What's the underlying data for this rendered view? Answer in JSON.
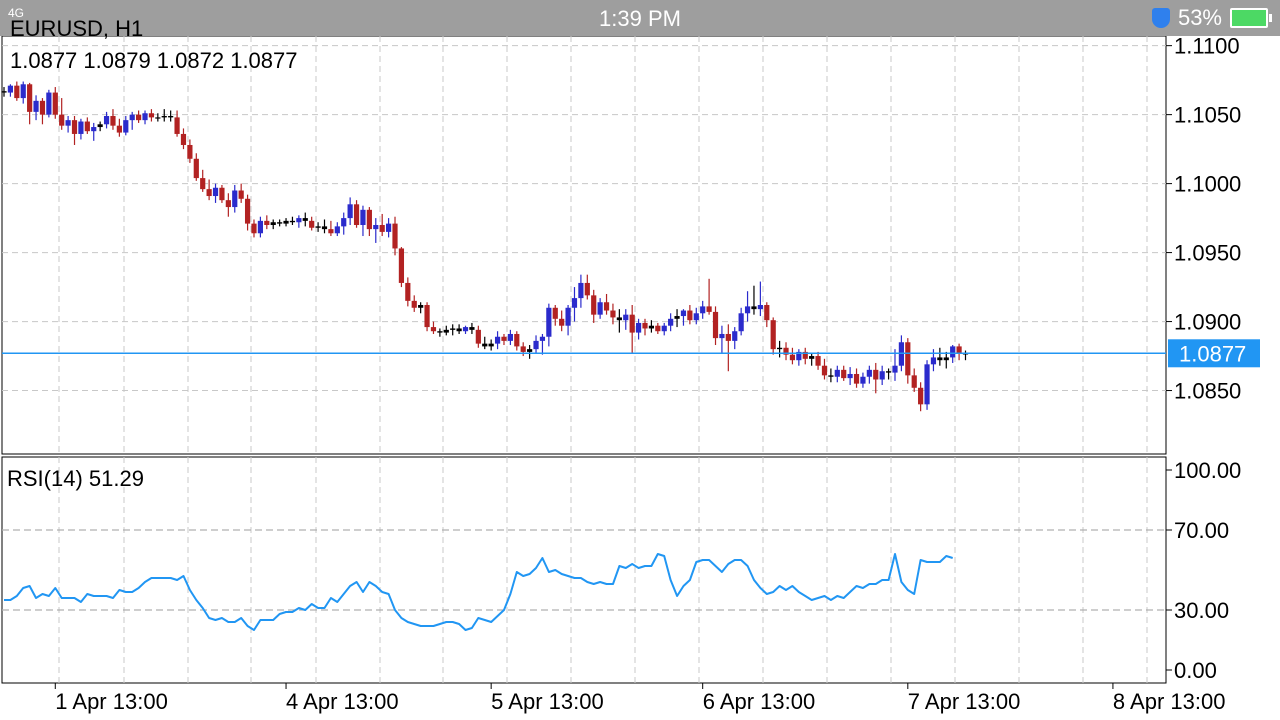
{
  "status_bar": {
    "time": "1:39 PM",
    "battery": "53%",
    "network": "4G"
  },
  "header": {
    "symbol_timeframe": "EURUSD, H1",
    "ohlc": "1.0877 1.0879 1.0872 1.0877"
  },
  "rsi_panel": {
    "label": "RSI(14) 51.29"
  },
  "colors": {
    "bull": "#2b2bcc",
    "bear": "#b22222",
    "rsi_line": "#2196f3",
    "price_line": "#2196f3",
    "grid": "#c8c8c8"
  },
  "chart_data": [
    {
      "type": "candlestick",
      "symbol": "EURUSD",
      "timeframe": "H1",
      "current_price": "1.0877",
      "y_ticks": [
        "1.1100",
        "1.1050",
        "1.1000",
        "1.0950",
        "1.0900",
        "1.0850"
      ],
      "ylim": [
        1.0804,
        1.1107
      ],
      "x_ticks": [
        "1 Apr 13:00",
        "4 Apr 13:00",
        "5 Apr 13:00",
        "6 Apr 13:00",
        "7 Apr 13:00",
        "8 Apr 13:00"
      ],
      "x_tick_bar_index": [
        8,
        44,
        76,
        109,
        141,
        173
      ],
      "candles": [
        [
          1.1067,
          1.107,
          1.1063,
          1.1066
        ],
        [
          1.1066,
          1.1072,
          1.1063,
          1.1071
        ],
        [
          1.1071,
          1.1074,
          1.106,
          1.1062
        ],
        [
          1.1062,
          1.1074,
          1.1058,
          1.1072
        ],
        [
          1.1072,
          1.1073,
          1.1043,
          1.1052
        ],
        [
          1.1052,
          1.1064,
          1.1046,
          1.106
        ],
        [
          1.106,
          1.1062,
          1.1043,
          1.105
        ],
        [
          1.105,
          1.1068,
          1.1048,
          1.1066
        ],
        [
          1.1066,
          1.107,
          1.1047,
          1.105
        ],
        [
          1.105,
          1.1062,
          1.1039,
          1.1042
        ],
        [
          1.1042,
          1.1049,
          1.1037,
          1.1046
        ],
        [
          1.1046,
          1.1049,
          1.1028,
          1.1036
        ],
        [
          1.1036,
          1.1047,
          1.1032,
          1.1045
        ],
        [
          1.1045,
          1.1048,
          1.1036,
          1.1038
        ],
        [
          1.1038,
          1.1044,
          1.1031,
          1.1041
        ],
        [
          1.1041,
          1.1045,
          1.1038,
          1.1043
        ],
        [
          1.1043,
          1.1052,
          1.104,
          1.1049
        ],
        [
          1.1049,
          1.1054,
          1.1039,
          1.1042
        ],
        [
          1.1042,
          1.1047,
          1.1034,
          1.1037
        ],
        [
          1.1037,
          1.1049,
          1.1035,
          1.1046
        ],
        [
          1.1046,
          1.1052,
          1.1039,
          1.105
        ],
        [
          1.105,
          1.1053,
          1.1044,
          1.1046
        ],
        [
          1.1046,
          1.1053,
          1.1043,
          1.1051
        ],
        [
          1.1051,
          1.1054,
          1.1045,
          1.1048
        ],
        [
          1.1048,
          1.1051,
          1.1045,
          1.1048
        ],
        [
          1.1048,
          1.1054,
          1.1045,
          1.1049
        ],
        [
          1.1049,
          1.1053,
          1.1045,
          1.1048
        ],
        [
          1.1048,
          1.1053,
          1.1034,
          1.1036
        ],
        [
          1.1036,
          1.104,
          1.1025,
          1.1028
        ],
        [
          1.1028,
          1.1032,
          1.1015,
          1.1018
        ],
        [
          1.1018,
          1.1022,
          1.1002,
          1.1004
        ],
        [
          1.1004,
          1.101,
          1.0994,
          1.0996
        ],
        [
          1.0996,
          1.1003,
          1.0988,
          1.0991
        ],
        [
          1.0991,
          1.1,
          1.0986,
          1.0997
        ],
        [
          1.0997,
          1.0999,
          1.0986,
          1.0988
        ],
        [
          1.0988,
          1.0993,
          1.0976,
          1.0983
        ],
        [
          1.0983,
          1.0999,
          1.0979,
          1.0995
        ],
        [
          1.0995,
          1.1,
          1.0986,
          1.0989
        ],
        [
          1.0989,
          1.0992,
          1.0966,
          1.0971
        ],
        [
          1.0971,
          1.0974,
          1.0961,
          1.0964
        ],
        [
          1.0964,
          1.0976,
          1.0961,
          1.0973
        ],
        [
          1.0973,
          1.0977,
          1.0967,
          1.097
        ],
        [
          1.097,
          1.0974,
          1.0967,
          1.0972
        ],
        [
          1.0972,
          1.0974,
          1.0969,
          1.0971
        ],
        [
          1.0971,
          1.0975,
          1.0969,
          1.0973
        ],
        [
          1.0973,
          1.0976,
          1.097,
          1.0972
        ],
        [
          1.0972,
          1.0977,
          1.0968,
          1.0975
        ],
        [
          1.0975,
          1.0979,
          1.0969,
          1.0973
        ],
        [
          1.0973,
          1.0976,
          1.0966,
          1.0968
        ],
        [
          1.0968,
          1.0972,
          1.0965,
          1.0969
        ],
        [
          1.0969,
          1.0974,
          1.0964,
          1.0967
        ],
        [
          1.0967,
          1.0973,
          1.0962,
          1.0964
        ],
        [
          1.0964,
          1.0972,
          1.0962,
          1.0969
        ],
        [
          1.0969,
          1.0979,
          1.0963,
          1.0975
        ],
        [
          1.0975,
          1.099,
          1.097,
          1.0985
        ],
        [
          1.0985,
          1.0988,
          1.0968,
          1.097
        ],
        [
          1.097,
          1.0984,
          1.0962,
          1.0981
        ],
        [
          1.0981,
          1.0983,
          1.0962,
          1.0967
        ],
        [
          1.0967,
          1.0975,
          1.0957,
          1.097
        ],
        [
          1.097,
          1.0978,
          1.0962,
          1.0965
        ],
        [
          1.0965,
          1.0975,
          1.0961,
          1.0971
        ],
        [
          1.0971,
          1.0976,
          1.0948,
          1.0953
        ],
        [
          1.0953,
          1.0954,
          1.0925,
          1.0928
        ],
        [
          1.0928,
          1.0932,
          1.0911,
          1.0915
        ],
        [
          1.0915,
          1.0919,
          1.0907,
          1.091
        ],
        [
          1.091,
          1.0914,
          1.0906,
          1.0912
        ],
        [
          1.0912,
          1.0914,
          1.0893,
          1.0896
        ],
        [
          1.0896,
          1.09,
          1.0891,
          1.0893
        ],
        [
          1.0893,
          1.0895,
          1.0889,
          1.0892
        ],
        [
          1.0892,
          1.0897,
          1.089,
          1.0894
        ],
        [
          1.0894,
          1.0898,
          1.089,
          1.0895
        ],
        [
          1.0895,
          1.0898,
          1.0891,
          1.0893
        ],
        [
          1.0893,
          1.0897,
          1.0891,
          1.0896
        ],
        [
          1.0896,
          1.0899,
          1.0891,
          1.0894
        ],
        [
          1.0894,
          1.0897,
          1.0881,
          1.0884
        ],
        [
          1.0884,
          1.0889,
          1.088,
          1.0882
        ],
        [
          1.0882,
          1.0887,
          1.0879,
          1.0884
        ],
        [
          1.0884,
          1.0893,
          1.088,
          1.0889
        ],
        [
          1.0889,
          1.0891,
          1.0883,
          1.0886
        ],
        [
          1.0886,
          1.0894,
          1.0883,
          1.0891
        ],
        [
          1.0891,
          1.0893,
          1.0879,
          1.0882
        ],
        [
          1.0882,
          1.0885,
          1.0875,
          1.0878
        ],
        [
          1.0878,
          1.0883,
          1.0873,
          1.088
        ],
        [
          1.088,
          1.089,
          1.0877,
          1.0886
        ],
        [
          1.0886,
          1.0891,
          1.0876,
          1.0889
        ],
        [
          1.0889,
          1.0913,
          1.0882,
          1.091
        ],
        [
          1.091,
          1.0912,
          1.0897,
          1.0902
        ],
        [
          1.0902,
          1.0908,
          1.0893,
          1.0897
        ],
        [
          1.0897,
          1.0912,
          1.089,
          1.091
        ],
        [
          1.091,
          1.0925,
          1.09,
          1.0917
        ],
        [
          1.0917,
          1.0934,
          1.091,
          1.0928
        ],
        [
          1.0928,
          1.0934,
          1.0916,
          1.0919
        ],
        [
          1.0919,
          1.0923,
          1.0899,
          1.0905
        ],
        [
          1.0905,
          1.0917,
          1.0902,
          1.0914
        ],
        [
          1.0914,
          1.092,
          1.0905,
          1.0908
        ],
        [
          1.0908,
          1.0913,
          1.0898,
          1.0903
        ],
        [
          1.0903,
          1.0909,
          1.0892,
          1.0901
        ],
        [
          1.0901,
          1.0909,
          1.0894,
          1.0905
        ],
        [
          1.0905,
          1.0912,
          1.0877,
          1.0892
        ],
        [
          1.0892,
          1.0902,
          1.0887,
          1.0899
        ],
        [
          1.0899,
          1.0902,
          1.089,
          1.0895
        ],
        [
          1.0895,
          1.0901,
          1.0892,
          1.0897
        ],
        [
          1.0897,
          1.0899,
          1.0891,
          1.0893
        ],
        [
          1.0893,
          1.0899,
          1.089,
          1.0897
        ],
        [
          1.0897,
          1.0906,
          1.0893,
          1.0902
        ],
        [
          1.0902,
          1.0909,
          1.0896,
          1.0904
        ],
        [
          1.0904,
          1.0909,
          1.0897,
          1.0908
        ],
        [
          1.0908,
          1.0912,
          1.0898,
          1.0901
        ],
        [
          1.0901,
          1.091,
          1.0898,
          1.0906
        ],
        [
          1.0906,
          1.0915,
          1.0902,
          1.0911
        ],
        [
          1.0911,
          1.0931,
          1.0905,
          1.0907
        ],
        [
          1.0907,
          1.0911,
          1.0883,
          1.0888
        ],
        [
          1.0888,
          1.0897,
          1.0877,
          1.0891
        ],
        [
          1.0891,
          1.0898,
          1.0864,
          1.0886
        ],
        [
          1.0886,
          1.0896,
          1.088,
          1.0893
        ],
        [
          1.0893,
          1.091,
          1.089,
          1.0906
        ],
        [
          1.0906,
          1.0922,
          1.09,
          1.0911
        ],
        [
          1.0911,
          1.0926,
          1.0905,
          1.0909
        ],
        [
          1.0909,
          1.0929,
          1.0904,
          1.0912
        ],
        [
          1.0912,
          1.0914,
          1.0896,
          1.0901
        ],
        [
          1.0901,
          1.0903,
          1.0876,
          1.088
        ],
        [
          1.088,
          1.0886,
          1.0874,
          1.0881
        ],
        [
          1.0881,
          1.0885,
          1.0872,
          1.0876
        ],
        [
          1.0876,
          1.0881,
          1.0869,
          1.0872
        ],
        [
          1.0872,
          1.088,
          1.0868,
          1.0878
        ],
        [
          1.0878,
          1.0881,
          1.0869,
          1.0873
        ],
        [
          1.0873,
          1.0877,
          1.0868,
          1.0875
        ],
        [
          1.0875,
          1.0878,
          1.0865,
          1.0868
        ],
        [
          1.0868,
          1.0873,
          1.0858,
          1.0861
        ],
        [
          1.0861,
          1.0866,
          1.0856,
          1.086
        ],
        [
          1.086,
          1.0868,
          1.0856,
          1.0865
        ],
        [
          1.0865,
          1.0868,
          1.0857,
          1.0859
        ],
        [
          1.0859,
          1.0867,
          1.0854,
          1.0862
        ],
        [
          1.0862,
          1.0866,
          1.0852,
          1.0855
        ],
        [
          1.0855,
          1.0863,
          1.0852,
          1.086
        ],
        [
          1.086,
          1.0868,
          1.0855,
          1.0865
        ],
        [
          1.0865,
          1.087,
          1.0848,
          1.0858
        ],
        [
          1.0858,
          1.0868,
          1.0854,
          1.0864
        ],
        [
          1.0864,
          1.0866,
          1.0858,
          1.0863
        ],
        [
          1.0863,
          1.088,
          1.0857,
          1.0868
        ],
        [
          1.0868,
          1.089,
          1.0864,
          1.0885
        ],
        [
          1.0885,
          1.0888,
          1.0855,
          1.0861
        ],
        [
          1.0861,
          1.0866,
          1.0849,
          1.0852
        ],
        [
          1.0852,
          1.0856,
          1.0835,
          1.084
        ],
        [
          1.084,
          1.0872,
          1.0836,
          1.0869
        ],
        [
          1.0869,
          1.088,
          1.0864,
          1.0874
        ],
        [
          1.0874,
          1.0881,
          1.0868,
          1.0872
        ],
        [
          1.0872,
          1.0878,
          1.0866,
          1.0874
        ],
        [
          1.0874,
          1.0883,
          1.087,
          1.0882
        ],
        [
          1.0882,
          1.0884,
          1.0872,
          1.0877
        ],
        [
          1.0877,
          1.0879,
          1.0872,
          1.0877
        ]
      ]
    },
    {
      "type": "line",
      "indicator": "RSI(14)",
      "label": "RSI(14) 51.29",
      "y_ticks": [
        "100.00",
        "70.00",
        "30.00",
        "0.00"
      ],
      "ylim": [
        0,
        100
      ],
      "levels": [
        70,
        30
      ],
      "series": [
        {
          "values": [
            35,
            35,
            37,
            41,
            42,
            36,
            38,
            37,
            41,
            36,
            36,
            36,
            34,
            38,
            37,
            37,
            37,
            36,
            40,
            39,
            39,
            41,
            44,
            46,
            46,
            46,
            46,
            45,
            47,
            40,
            35,
            31,
            26,
            25,
            26,
            24,
            24,
            26,
            22,
            20,
            25,
            25,
            25,
            28,
            29,
            29,
            31,
            30,
            33,
            31,
            31,
            36,
            34,
            38,
            42,
            44,
            39,
            44,
            42,
            39,
            38,
            30,
            26,
            24,
            23,
            22,
            22,
            22,
            23,
            24,
            24,
            23,
            20,
            21,
            26,
            25,
            24,
            27,
            30,
            38,
            49,
            47,
            48,
            51,
            56,
            49,
            50,
            48,
            47,
            46,
            46,
            44,
            43,
            44,
            43,
            43,
            52,
            51,
            53,
            51,
            52,
            52,
            58,
            57,
            45,
            37,
            42,
            45,
            54,
            55,
            55,
            52,
            49,
            53,
            55,
            55,
            52,
            45,
            41,
            38,
            39,
            42,
            40,
            42,
            39,
            37,
            35,
            36,
            37,
            35,
            37,
            36,
            39,
            42,
            41,
            43,
            43,
            45,
            45,
            58,
            44,
            40,
            38,
            55,
            54,
            54,
            54,
            57,
            56
          ]
        }
      ]
    }
  ]
}
